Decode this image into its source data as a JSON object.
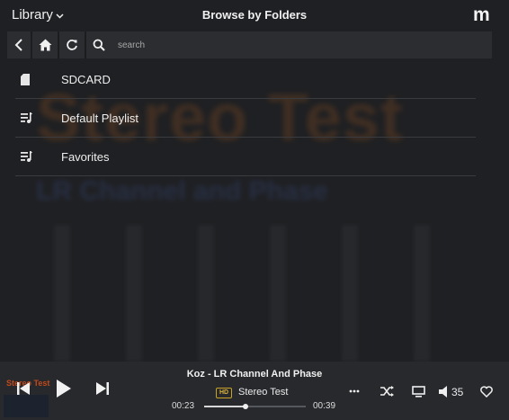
{
  "header": {
    "library_label": "Library",
    "title": "Browse by Folders",
    "logo_text": "m"
  },
  "toolbar": {
    "search_placeholder": "search"
  },
  "list": [
    {
      "label": "SDCARD",
      "icon": "sd-card-icon"
    },
    {
      "label": "Default Playlist",
      "icon": "playlist-icon"
    },
    {
      "label": "Favorites",
      "icon": "playlist-icon"
    }
  ],
  "background_art": {
    "title": "Stereo Test",
    "subtitle": "LR Channel and Phase"
  },
  "player": {
    "thumb_text": "Stereo Test",
    "track_title": "Koz - LR Channel And Phase",
    "quality_badge": "HD",
    "album": "Stereo Test",
    "elapsed": "00:23",
    "total": "00:39",
    "progress_fraction": 0.41,
    "volume": "35"
  },
  "colors": {
    "background": "#1f2023",
    "bar": "#27292c",
    "hd_badge": "#c9a227"
  }
}
